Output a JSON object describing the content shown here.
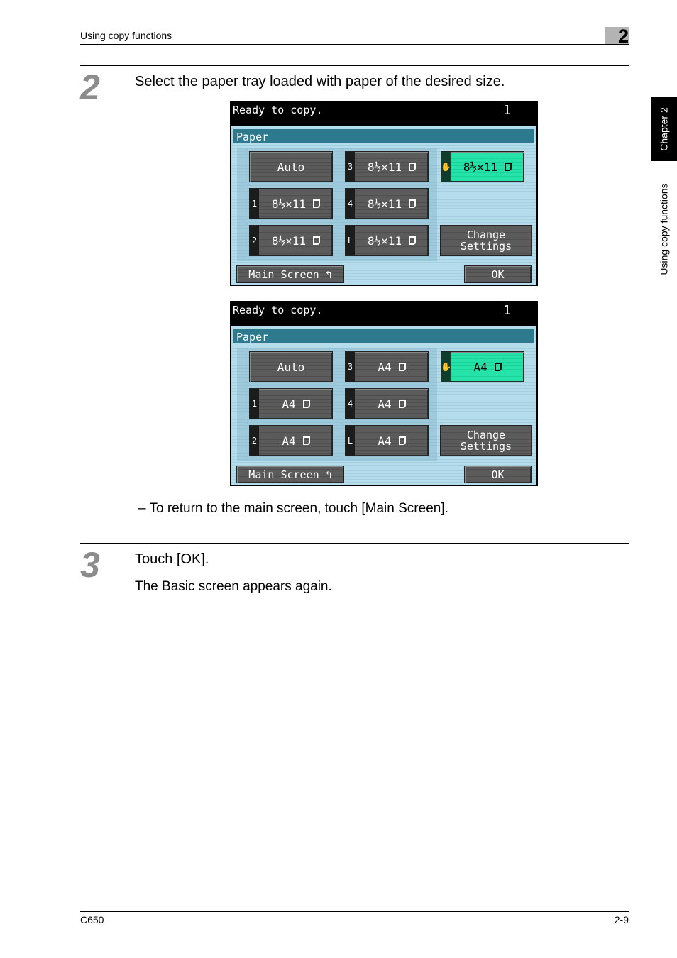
{
  "header": {
    "section": "Using copy functions",
    "chapter_number": "2"
  },
  "side_tabs": {
    "chapter": "Chapter 2",
    "section": "Using copy functions"
  },
  "steps": [
    {
      "number": "2",
      "text": "Select the paper tray loaded with paper of the desired size."
    },
    {
      "number": "3",
      "text": "Touch [OK].",
      "subtext": "The Basic screen appears again."
    }
  ],
  "note": "–  To return to the main screen, touch [Main Screen].",
  "panels": [
    {
      "status": "Ready to copy.",
      "count": "1",
      "title": "Paper",
      "auto_label": "Auto",
      "trays": [
        {
          "tag": "3",
          "size": "8½×11"
        },
        {
          "tag": "✋",
          "size": "8½×11",
          "selected": true
        },
        {
          "tag": "1",
          "size": "8½×11"
        },
        {
          "tag": "4",
          "size": "8½×11"
        },
        {
          "tag": "2",
          "size": "8½×11"
        },
        {
          "tag": "L",
          "size": "8½×11"
        }
      ],
      "change_settings": [
        "Change",
        "Settings"
      ],
      "main_screen": "Main Screen ↰",
      "ok": "OK"
    },
    {
      "status": "Ready to copy.",
      "count": "1",
      "title": "Paper",
      "auto_label": "Auto",
      "trays": [
        {
          "tag": "3",
          "size": "A4"
        },
        {
          "tag": "✋",
          "size": "A4",
          "selected": true
        },
        {
          "tag": "1",
          "size": "A4"
        },
        {
          "tag": "4",
          "size": "A4"
        },
        {
          "tag": "2",
          "size": "A4"
        },
        {
          "tag": "L",
          "size": "A4"
        }
      ],
      "change_settings": [
        "Change",
        "Settings"
      ],
      "main_screen": "Main Screen ↰",
      "ok": "OK"
    }
  ],
  "footer": {
    "model": "C650",
    "page": "2-9"
  },
  "colors": {
    "selected": "#24e2a8",
    "title_bar": "#2d7a8e",
    "screen_bg": "#b4dcea",
    "step_number": "#8c8c8c"
  }
}
